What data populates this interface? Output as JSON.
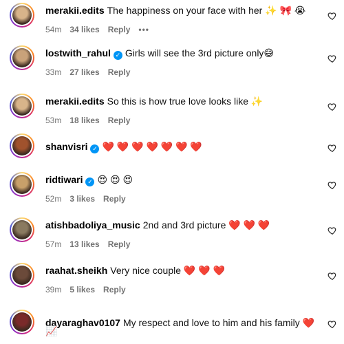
{
  "comments": [
    {
      "username": "merakii.edits",
      "verified": false,
      "text": "The happiness on your face with her ✨ 🎀 😭",
      "time": "54m",
      "likes": "34 likes",
      "reply": "Reply",
      "more": "•••",
      "avatar_color": "#d8b48a"
    },
    {
      "username": "lostwith_rahul",
      "verified": true,
      "text": "Girls will see the 3rd picture only😅",
      "time": "33m",
      "likes": "27 likes",
      "reply": "Reply",
      "avatar_color": "#c9a27a"
    },
    {
      "username": "merakii.edits",
      "verified": false,
      "text": "So this is how true love looks like ✨",
      "time": "53m",
      "likes": "18 likes",
      "reply": "Reply",
      "avatar_color": "#d8b48a"
    },
    {
      "username": "shanvisri",
      "verified": true,
      "text": "❤️ ❤️ ❤️ ❤️ ❤️ ❤️ ❤️",
      "time": "",
      "likes": "",
      "reply": "",
      "avatar_color": "#a0522d"
    },
    {
      "username": "ridtiwari",
      "verified": true,
      "text": "😍 😍 😍",
      "time": "52m",
      "likes": "3 likes",
      "reply": "Reply",
      "avatar_color": "#c8a06a"
    },
    {
      "username": "atishbadoliya_music",
      "verified": false,
      "text": "2nd and 3rd picture ❤️ ❤️ ❤️",
      "time": "57m",
      "likes": "13 likes",
      "reply": "Reply",
      "avatar_color": "#8a7a60"
    },
    {
      "username": "raahat.sheikh",
      "verified": false,
      "text": "Very nice couple ❤️ ❤️ ❤️",
      "time": "39m",
      "likes": "5 likes",
      "reply": "Reply",
      "avatar_color": "#6b4a3a"
    },
    {
      "username": "dayaraghav0107",
      "verified": false,
      "text": "My respect and love to him and his family ❤️",
      "text2": "📈",
      "time": "",
      "likes": "",
      "reply": "",
      "avatar_color": "#7a2a2a"
    }
  ],
  "colors": {
    "accent": "#0095f6",
    "muted": "#737373"
  }
}
